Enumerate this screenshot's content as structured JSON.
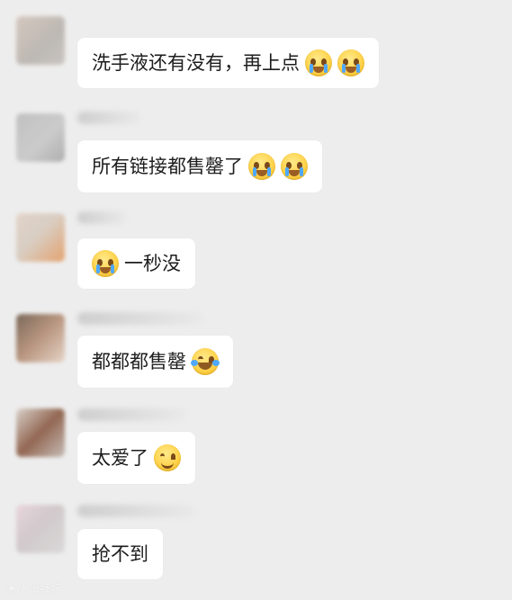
{
  "messages": [
    {
      "text": "洗手液还有没有，再上点",
      "emojis": [
        "crying-face",
        "crying-face"
      ]
    },
    {
      "text": "所有链接都售罄了",
      "emojis": [
        "crying-face",
        "crying-face"
      ]
    },
    {
      "text": "一秒没",
      "emojis": [
        "crying-face"
      ]
    },
    {
      "text": "都都都售罄",
      "emojis": [
        "tears-of-joy-face"
      ]
    },
    {
      "text": "太爱了",
      "emojis": [
        "smiling-face"
      ]
    },
    {
      "text": "抢不到",
      "emojis": []
    }
  ],
  "watermark": {
    "text": "大嘴播报"
  },
  "colors": {
    "background": "#ededed",
    "bubble": "#ffffff",
    "text": "#1d1d1d"
  }
}
